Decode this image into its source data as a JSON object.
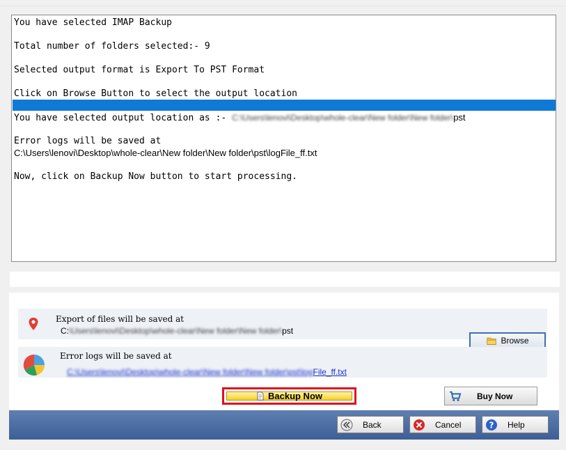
{
  "log": {
    "lines": [
      "You have selected IMAP Backup",
      "Total number of folders selected:- 9",
      "Selected output format is Export To PST Format",
      "Click on Browse Button to select the output location",
      "You have selected output location as :-",
      "Error logs will be saved at",
      "Now, click on Backup Now button to start processing."
    ],
    "output_path_blurred": "C:\\Users\\lenovi\\Desktop\\whole-clear\\New folder\\New folder\\",
    "output_path_tail": "pst",
    "errlog_path_blurred": "C:\\Users\\lenovi\\Desktop\\whole-clear\\New  folder\\New  folder\\pst\\log",
    "errlog_path_tail": "File_ff.txt"
  },
  "export_row": {
    "title": "Export of files will be saved at",
    "path_head": "C:",
    "path_blurred": "\\Users\\lenovi\\Desktop\\whole-clear\\New folder\\New folder\\",
    "path_tail": "pst",
    "browse_label": "Browse"
  },
  "logs_row": {
    "title": "Error logs will be saved at",
    "link_blurred": "C:\\Users\\lenovi\\Desktop\\whole-clear\\New folder\\New folder\\pst\\log",
    "link_tail": "File_ff.txt"
  },
  "actions": {
    "backup_now_label": "Backup Now",
    "buy_now_label": "Buy Now"
  },
  "footer": {
    "back_label": "Back",
    "cancel_label": "Cancel",
    "help_label": "Help"
  },
  "colors": {
    "selection_highlight": "#0f7ad5",
    "footer_bar": "#4a6aa3",
    "backup_frame": "#e0101d",
    "link": "#1a33cc"
  },
  "icons": {
    "export_row": "location-pin-icon",
    "logs_row": "pie-chart-icon",
    "browse": "folder-icon",
    "backup": "document-icon",
    "buy": "shopping-cart-icon",
    "back": "back-arrow-icon",
    "cancel": "cancel-x-icon",
    "help": "help-question-icon"
  }
}
